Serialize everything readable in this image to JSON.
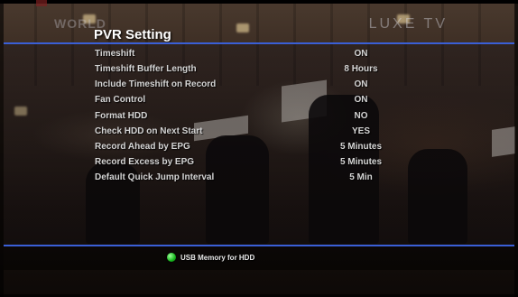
{
  "channel": {
    "left_logo": "WORLD",
    "right_logo": "LUXE TV"
  },
  "menu": {
    "title": "PVR Setting",
    "items": [
      {
        "label": "Timeshift",
        "value": "ON"
      },
      {
        "label": "Timeshift Buffer Length",
        "value": "8 Hours"
      },
      {
        "label": "Include Timeshift on Record",
        "value": "ON"
      },
      {
        "label": "Fan Control",
        "value": "ON"
      },
      {
        "label": "Format HDD",
        "value": "NO"
      },
      {
        "label": "Check HDD on Next Start",
        "value": "YES"
      },
      {
        "label": "Record Ahead by EPG",
        "value": "5 Minutes"
      },
      {
        "label": "Record Excess by EPG",
        "value": "5 Minutes"
      },
      {
        "label": "Default Quick Jump Interval",
        "value": "5 Min"
      }
    ]
  },
  "footer": {
    "green_hint": "USB Memory for HDD"
  },
  "colors": {
    "accent_line": "#3a5fd6",
    "green_key": "#16b41c",
    "text": "#d4d4d4"
  }
}
